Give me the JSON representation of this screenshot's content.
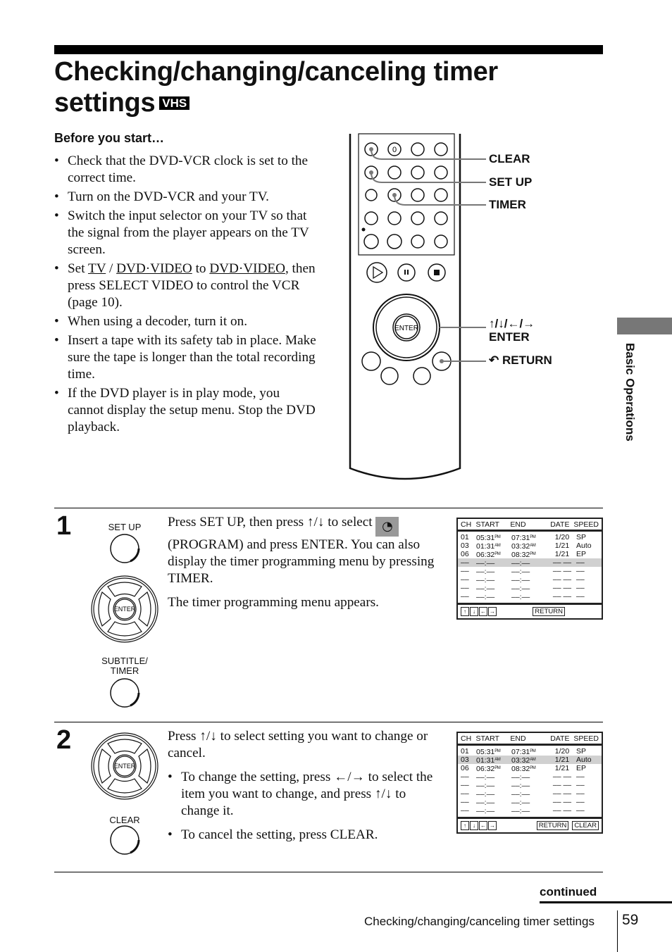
{
  "title": {
    "line1": "Checking/changing/canceling timer",
    "line2": "settings",
    "badge": "VHS"
  },
  "before_you_start": {
    "heading": "Before you start…",
    "items": [
      {
        "text": "Check that the DVD-VCR clock is set to the correct time."
      },
      {
        "text": "Turn on the DVD-VCR and your TV."
      },
      {
        "text": "Switch the input selector on your TV so that the signal from the player appears on the TV screen."
      },
      {
        "pre": "Set ",
        "u1": "TV",
        "mid1": " / ",
        "u2": "DVD·VIDEO",
        "mid2": " to ",
        "u3": "DVD·VIDEO",
        "post": ", then press SELECT VIDEO to control the VCR (page 10)."
      },
      {
        "text": "When using a decoder, turn it on."
      },
      {
        "text": "Insert a tape with its safety tab in place. Make sure the tape is longer than the total recording time."
      },
      {
        "text": "If the DVD player is in play mode, you cannot display the setup menu.  Stop the DVD playback."
      }
    ]
  },
  "remote_labels": {
    "clear": "CLEAR",
    "setup": "SET UP",
    "timer": "TIMER",
    "arrows": "↑/↓/←/→",
    "enter": "ENTER",
    "return": "RETURN",
    "zero_key": "0",
    "enter_key": "ENTER"
  },
  "side_tab": {
    "label": "Basic Operations"
  },
  "steps": [
    {
      "number": "1",
      "buttons": {
        "top": "SET UP",
        "bottom": "SUBTITLE/ TIMER",
        "enter": "ENTER"
      },
      "para1_a": "Press SET UP, then press ↑/↓ to select",
      "para1_b": "(PROGRAM) and press ENTER.  You can also display the timer programming menu by pressing TIMER.",
      "para2": "The timer programming menu appears."
    },
    {
      "number": "2",
      "buttons": {
        "bottom": "CLEAR",
        "enter": "ENTER"
      },
      "para1": "Press ↑/↓ to select setting you want to change or cancel.",
      "bullets": [
        "To change the setting, press ←/→ to select the item you want to change, and press ↑/↓ to change it.",
        "To cancel the setting, press CLEAR."
      ]
    }
  ],
  "osd": {
    "headers": [
      "CH",
      "START",
      "END",
      "DATE",
      "SPEED"
    ],
    "rows": [
      {
        "ch": "01",
        "start": "05:31",
        "start_ampm": "PM",
        "end": "07:31",
        "end_ampm": "PM",
        "date": "1/20",
        "speed": "SP"
      },
      {
        "ch": "03",
        "start": "01:31",
        "start_ampm": "AM",
        "end": "03:32",
        "end_ampm": "AM",
        "date": "1/21",
        "speed": "Auto"
      },
      {
        "ch": "06",
        "start": "06:32",
        "start_ampm": "PM",
        "end": "08:32",
        "end_ampm": "PM",
        "date": "1/21",
        "speed": "EP"
      },
      {
        "ch": "––",
        "start": "––:––",
        "start_ampm": "",
        "end": "––:––",
        "end_ampm": "",
        "date": "–– ––",
        "speed": "––"
      },
      {
        "ch": "––",
        "start": "––:––",
        "start_ampm": "",
        "end": "––:––",
        "end_ampm": "",
        "date": "–– ––",
        "speed": "––"
      },
      {
        "ch": "––",
        "start": "––:––",
        "start_ampm": "",
        "end": "––:––",
        "end_ampm": "",
        "date": "–– ––",
        "speed": "––"
      },
      {
        "ch": "––",
        "start": "––:––",
        "start_ampm": "",
        "end": "––:––",
        "end_ampm": "",
        "date": "–– ––",
        "speed": "––"
      },
      {
        "ch": "––",
        "start": "––:––",
        "start_ampm": "",
        "end": "––:––",
        "end_ampm": "",
        "date": "–– ––",
        "speed": "––"
      }
    ],
    "arrows": [
      "↑",
      "↓",
      "←",
      "→"
    ],
    "return_label": "RETURN",
    "clear_label": "CLEAR",
    "screen1_highlight_row": 3,
    "screen2_highlight_row": 1
  },
  "footer": {
    "continued": "continued",
    "section": "Checking/changing/canceling timer settings",
    "page": "59"
  }
}
